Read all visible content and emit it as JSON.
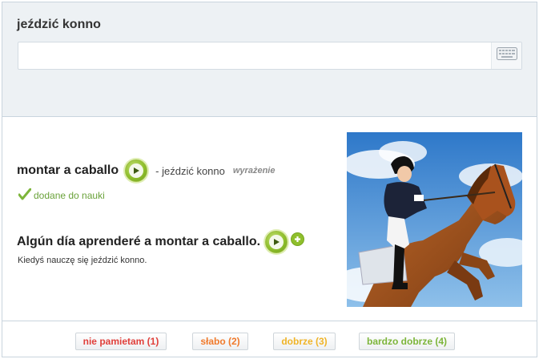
{
  "question": {
    "prompt": "jeździć konno",
    "answer_value": "",
    "keyboard_icon": "keyboard-icon"
  },
  "word": {
    "spanish": "montar a caballo",
    "separator_translation": "- jeździć konno",
    "type": "wyrażenie",
    "play_icon": "play-icon"
  },
  "status": {
    "added_label": "dodane do nauki",
    "icon": "checkmark-icon"
  },
  "sentence": {
    "spanish": "Algún día aprenderé a montar a caballo.",
    "polish": "Kiedyś nauczę się jeździć konno.",
    "play_icon": "play-icon",
    "add_icon": "plus-icon"
  },
  "image": {
    "subject": "rider jumping on horse"
  },
  "ratings": [
    {
      "label": "nie pamietam (1)",
      "color": "#e0403b"
    },
    {
      "label": "słabo (2)",
      "color": "#f07a2c"
    },
    {
      "label": "dobrze (3)",
      "color": "#f0b428"
    },
    {
      "label": "bardzo dobrze (4)",
      "color": "#7db53a"
    }
  ],
  "colors": {
    "accent_green": "#8fbf2c",
    "panel_bg": "#edf1f4",
    "border": "#c9d4de"
  }
}
